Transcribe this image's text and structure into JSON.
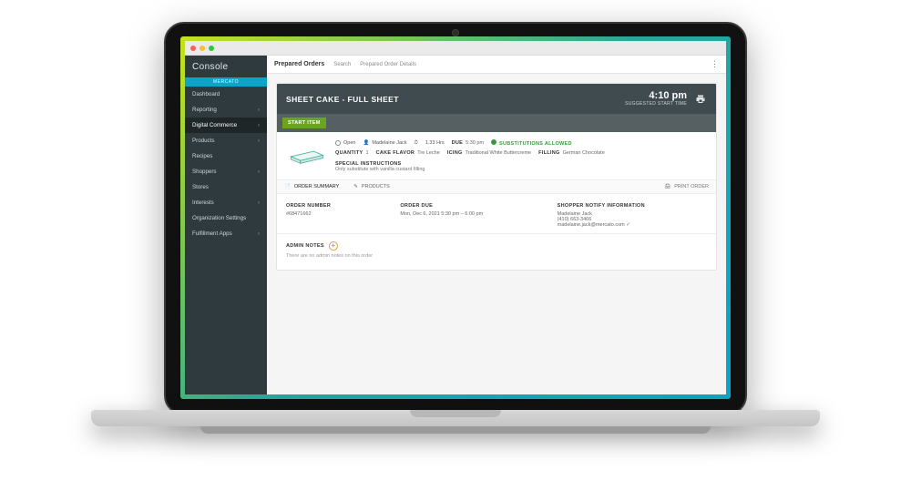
{
  "brand": "Console",
  "ribbon": "MERCATO",
  "sidebar": {
    "items": [
      {
        "label": "Dashboard",
        "chev": false
      },
      {
        "label": "Reporting",
        "chev": true
      },
      {
        "label": "Digital Commerce",
        "chev": true,
        "active": true
      },
      {
        "label": "Products",
        "chev": true
      },
      {
        "label": "Recipes",
        "chev": false
      },
      {
        "label": "Shoppers",
        "chev": true
      },
      {
        "label": "Stores",
        "chev": false
      },
      {
        "label": "Interests",
        "chev": true
      },
      {
        "label": "Organization Settings",
        "chev": false
      },
      {
        "label": "Fulfillment Apps",
        "chev": true
      }
    ]
  },
  "topbar": {
    "section": "Prepared Orders",
    "crumbs": [
      "Search",
      "Prepared Order Details"
    ]
  },
  "header": {
    "title": "SHEET CAKE - FULL SHEET",
    "due_time": "4:10 pm",
    "due_sub": "SUGGESTED START TIME"
  },
  "action": {
    "start": "START ITEM"
  },
  "item": {
    "status": "Open",
    "user": "Madelaine Jack",
    "duration": "1.33 Hrs",
    "due_label": "DUE",
    "due_value": "5:30 pm",
    "subs": "SUBSTITUTIONS ALLOWED",
    "attrs": [
      {
        "k": "QUANTITY",
        "v": "1"
      },
      {
        "k": "CAKE FLAVOR",
        "v": "Tre Leche"
      },
      {
        "k": "ICING",
        "v": "Traditional White Buttercreme"
      },
      {
        "k": "FILLING",
        "v": "German Chocolate"
      }
    ],
    "special_title": "SPECIAL INSTRUCTIONS",
    "special_text": "Only substitute with vanilla custard filling"
  },
  "tabs": {
    "summary": "ORDER SUMMARY",
    "products": "PRODUCTS",
    "print": "PRINT ORDER"
  },
  "summary": {
    "order_number_hd": "ORDER NUMBER",
    "order_number": "#68471662",
    "order_due_hd": "ORDER DUE",
    "order_due": "Mon, Dec 6, 2021 5:30 pm – 6:00 pm",
    "notify_hd": "SHOPPER NOTIFY INFORMATION",
    "notify_name": "Madelaine Jack",
    "notify_phone": "(410) 663-3466",
    "notify_email": "madelaine.jack@mercato.com"
  },
  "admin": {
    "title": "ADMIN NOTES",
    "empty": "There are no admin notes on this order"
  }
}
